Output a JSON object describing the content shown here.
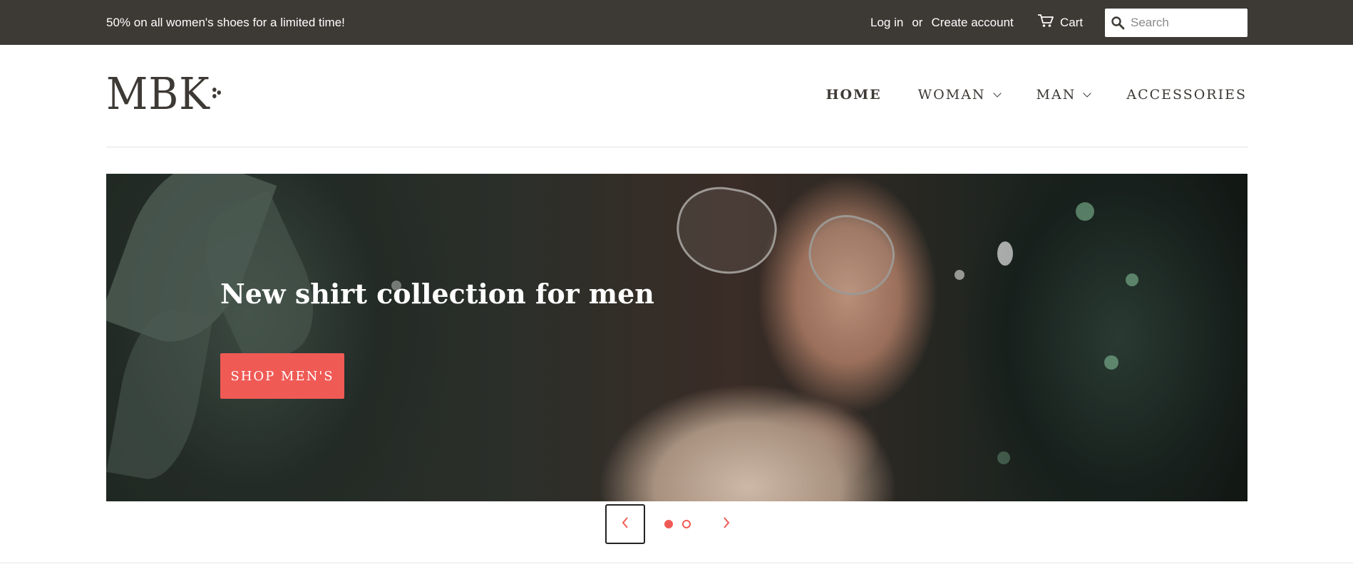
{
  "announcement": {
    "promo_text": "50% on all women's shoes for a limited time!",
    "login_label": "Log in",
    "or_label": "or",
    "create_account_label": "Create account",
    "cart_label": "Cart",
    "search_placeholder": "Search"
  },
  "header": {
    "logo_text": "MBK",
    "nav": [
      {
        "label": "HOME",
        "active": true,
        "has_dropdown": false
      },
      {
        "label": "WOMAN",
        "active": false,
        "has_dropdown": true
      },
      {
        "label": "MAN",
        "active": false,
        "has_dropdown": true
      },
      {
        "label": "ACCESSORIES",
        "active": false,
        "has_dropdown": false
      }
    ]
  },
  "hero": {
    "headline": "New shirt collection for men",
    "cta_label": "SHOP MEN'S"
  },
  "slider": {
    "slide_count": 2,
    "active_index": 0
  },
  "icons": {
    "search": "search-icon",
    "cart": "cart-icon",
    "prev": "chevron-left-icon",
    "next": "chevron-right-icon",
    "dropdown": "chevron-down-icon"
  },
  "colors": {
    "topbar_bg": "#3d3935",
    "accent": "#f05a55",
    "text_dark": "#3d3935"
  }
}
